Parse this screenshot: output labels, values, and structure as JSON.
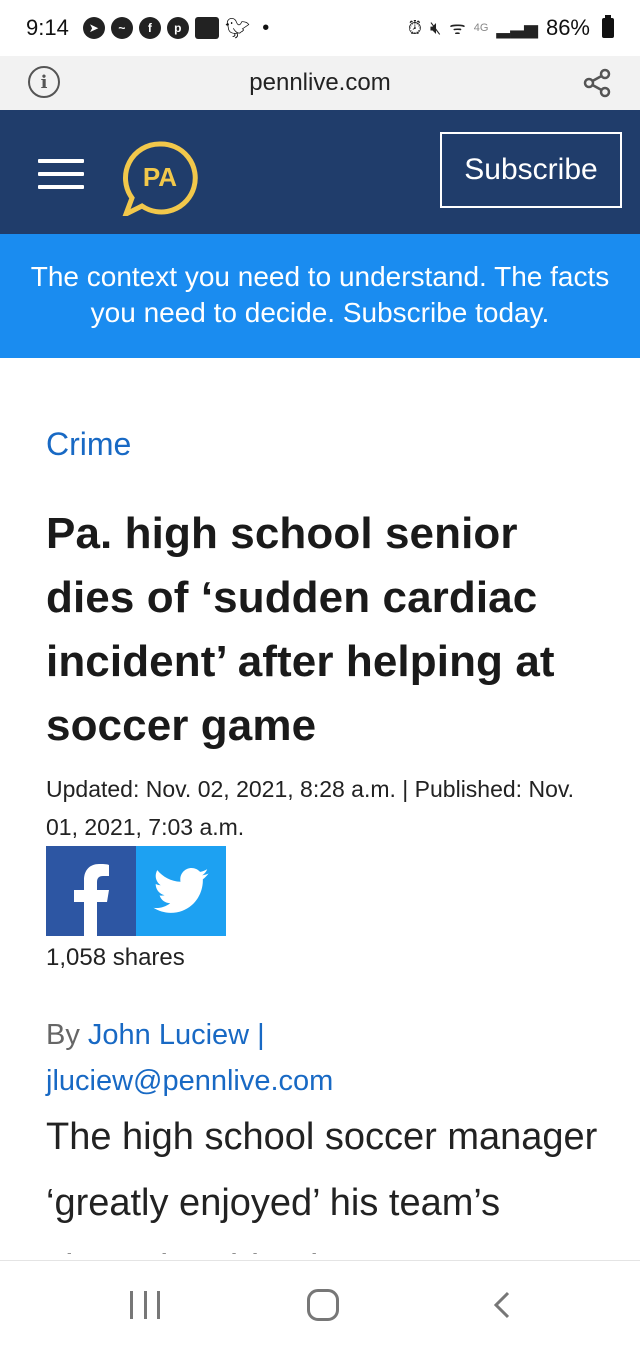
{
  "status_bar": {
    "time": "9:14",
    "battery": "86%",
    "network": "4G"
  },
  "browser": {
    "url": "pennlive.com"
  },
  "header": {
    "logo_text": "PA",
    "subscribe_label": "Subscribe",
    "brand_color": "#203d6b",
    "logo_accent": "#f2c84b"
  },
  "promo": {
    "text": "The context you need to understand. The facts you need to decide. Subscribe today.",
    "color": "#1a8cf0"
  },
  "article": {
    "section": "Crime",
    "headline": "Pa. high school senior dies of ‘sudden cardiac incident’ after helping at soccer game",
    "dateline": "Updated: Nov. 02, 2021, 8:28 a.m. | Published: Nov. 01, 2021, 7:03 a.m.",
    "shares": "1,058 shares",
    "byline_prefix": "By",
    "author": "John Luciew |",
    "author_email": "jluciew@pennlive.com",
    "body": "The high school soccer manager ‘greatly enjoyed’ his team’s championship victory"
  },
  "social": {
    "facebook_icon": "facebook-icon",
    "twitter_icon": "twitter-icon",
    "facebook_color": "#2d56a3",
    "twitter_color": "#1da1f2"
  },
  "nav": {
    "icons": [
      "recent-apps-icon",
      "home-icon",
      "back-icon"
    ]
  }
}
